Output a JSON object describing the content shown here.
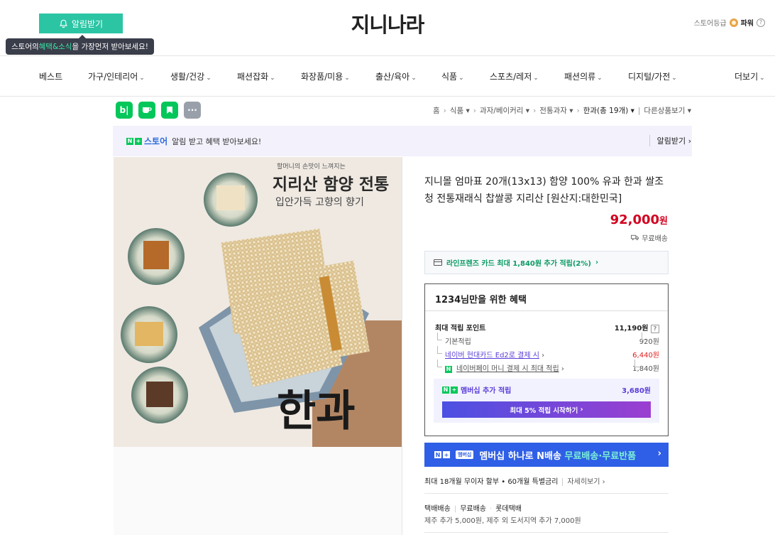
{
  "header": {
    "alarm_button": "알림받기",
    "tooltip_prefix": "스토어의 ",
    "tooltip_highlight": "혜택&소식",
    "tooltip_suffix": "을 가장먼저 받아보세요!",
    "store_name": "지니나라",
    "grade_label": "스토어등급",
    "grade_value": "파워",
    "grade_help": "?"
  },
  "nav": {
    "items": [
      {
        "label": "베스트"
      },
      {
        "label": "가구/인테리어"
      },
      {
        "label": "생활/건강"
      },
      {
        "label": "패션잡화"
      },
      {
        "label": "화장품/미용"
      },
      {
        "label": "출산/육아"
      },
      {
        "label": "식품"
      },
      {
        "label": "스포츠/레저"
      },
      {
        "label": "패션의류"
      },
      {
        "label": "디지털/가전"
      },
      {
        "label": "더보기"
      }
    ]
  },
  "share": {
    "blog": "b|",
    "more": "···"
  },
  "breadcrumb": {
    "home": "홈",
    "c1": "식품",
    "c2": "과자/베이커리",
    "c3": "전통과자",
    "current": "한과(총 19개)",
    "others": "다른상품보기"
  },
  "notice": {
    "n_label": "N",
    "plus": "+",
    "store_label": "스토어",
    "message": "알림 받고 혜택 받아보세요!",
    "button": "알림받기"
  },
  "image": {
    "caption_small": "할머니의 손맛이 느껴지는",
    "caption_title": "지리산 함양 전통",
    "caption_sub": "입안가득 고향의 향기",
    "calligraphy": "한과"
  },
  "product": {
    "title": "지니몰 엄마표 20개(13x13) 함양 100% 유과 한과 쌀조청 전통재래식 찹쌀콩 지리산 [원산지:대한민국]",
    "price": "92,000",
    "price_unit": "원",
    "shipping": "무료배송",
    "card_offer": "라인프렌즈 카드 최대 1,840원 추가 적립(2%)"
  },
  "benefit": {
    "title": "1234님만을 위한 혜택",
    "max_points_label": "최대 적립 포인트",
    "max_points_value": "11,190원",
    "help": "?",
    "rows": [
      {
        "label": "기본적립",
        "value": "920원"
      },
      {
        "label": "네이버 현대카드 Ed2로 결제 시",
        "value": "6,440원"
      },
      {
        "label": "네이버페이 머니 결제 시 최대 적립",
        "value": "1,840원"
      }
    ],
    "membership_label": "멤버십 추가 적립",
    "membership_value": "3,680원",
    "membership_button": "최대 5% 적립 시작하기"
  },
  "banner": {
    "tag": "멤버십",
    "text": "멤버십 하나로 N배송",
    "highlight": "무료배송·무료반품"
  },
  "installment": {
    "text": "최대 18개월 무이자 할부 • 60개월 특별금리",
    "more": "자세히보기"
  },
  "delivery": {
    "type": "택배배송",
    "fee": "무료배송",
    "carrier": "롯데택배",
    "extra": "제주 추가 5,000원, 제주 외 도서지역 추가 7,000원"
  },
  "colors": {
    "accent_green": "#2bc5a4",
    "price_red": "#d2001f",
    "naver_green": "#03c75a",
    "membership_purple": "#5a3dd8",
    "banner_blue": "#2f5fe6"
  }
}
